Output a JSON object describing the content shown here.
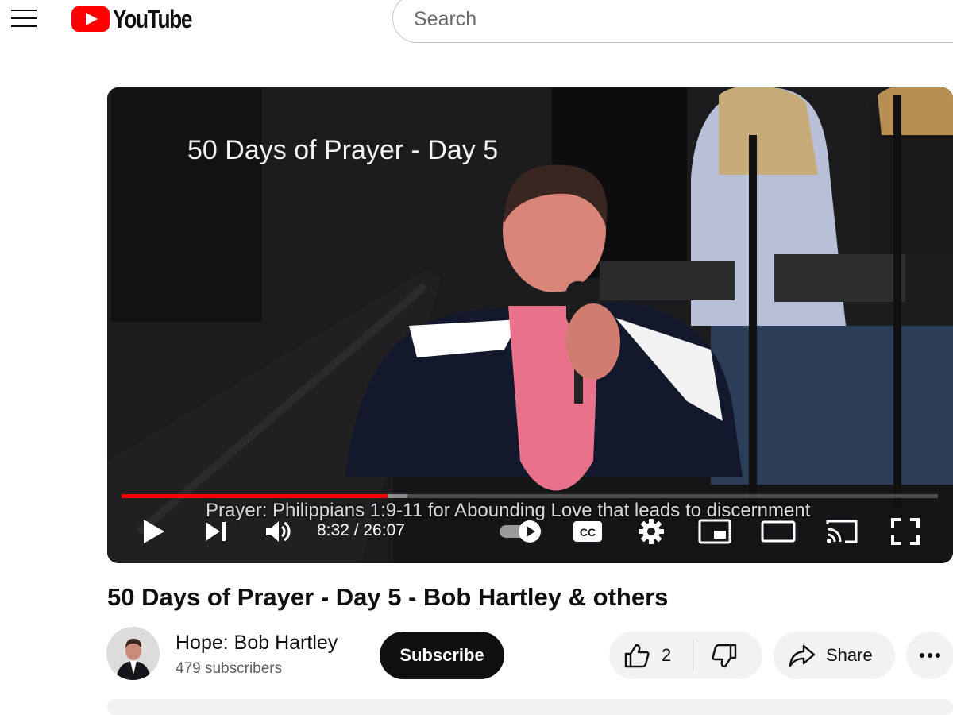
{
  "header": {
    "logo_text": "YouTube",
    "search_placeholder": "Search"
  },
  "player": {
    "overlay_title": "50 Days of Prayer - Day 5",
    "caption": "Prayer: Philippians 1:9-11 for Abounding Love that leads to discernment",
    "time_display": "8:32 / 26:07",
    "progress_played_fraction": 0.326,
    "progress_buffered_fraction": 0.35,
    "autoplay": true,
    "icons": [
      "play-icon",
      "next-icon",
      "volume-icon",
      "autoplay-toggle-icon",
      "cc-icon",
      "settings-gear-icon",
      "miniplayer-icon",
      "theater-icon",
      "cast-icon",
      "fullscreen-icon"
    ]
  },
  "video": {
    "title": "50 Days of Prayer - Day 5 - Bob Hartley & others"
  },
  "channel": {
    "name": "Hope: Bob Hartley",
    "subscribers": "479 subscribers",
    "subscribe_label": "Subscribe"
  },
  "actions": {
    "like_count": "2",
    "share_label": "Share"
  },
  "colors": {
    "brand_red": "#ff0000",
    "text_primary": "#0f0f0f",
    "text_secondary": "#606060",
    "chip_bg": "#f2f2f2"
  }
}
